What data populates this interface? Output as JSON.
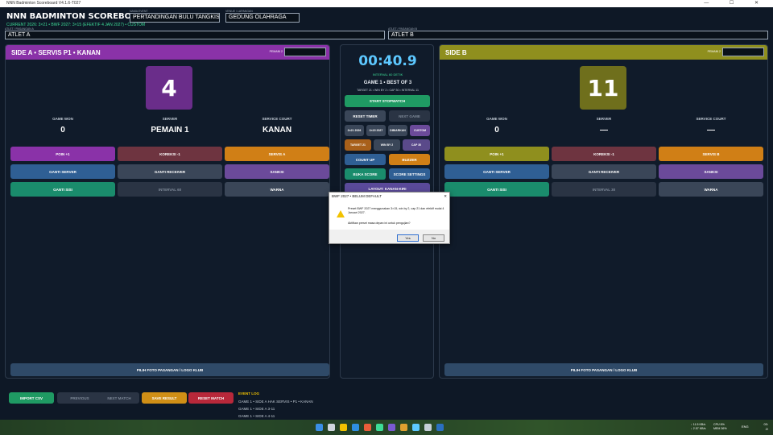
{
  "window": {
    "title": "NNN Badminton Scoreboard V4.1.6-T027",
    "controls": "— ☐ ✕"
  },
  "header": {
    "app_title": "NNN BADMINTON SCOREBOARD",
    "subtitle": "CURRENT 2026: 3×21 • BWF 2027: 3×15 (EFEKTIF 4 JAN 2027) • CUSTOM",
    "event_label": "NAMA EVENT",
    "event_value": "PERTANDINGAN BULU TANGKIS",
    "venue_label": "VENUE / LAPANGAN",
    "venue_value": "GEDUNG OLAHRAGA"
  },
  "athletes": {
    "a_label": "ATLET / PASANGAN A",
    "a_value": "ATLET A",
    "b_label": "ATLET / PASANGAN B",
    "b_value": "ATLET B"
  },
  "side_a": {
    "header": "SIDE A  • SERVIS P1 • KANAN",
    "player_label": "PEMAIN 2",
    "score": "4",
    "game_won_label": "GAME WON",
    "game_won": "0",
    "server_label": "SERVER",
    "server": "PEMAIN 1",
    "court_label": "SERVICE COURT",
    "court": "KANAN",
    "btn_point": "POIN +1",
    "btn_correct": "KOREKSI -1",
    "btn_serve": "SERVIS A",
    "btn_swap_server": "GANTI SERVER",
    "btn_swap_receiver": "GANTI RECEIVER",
    "btn_warn": "SANKSI",
    "btn_swap_side": "GANTI SISI",
    "btn_interval": "INTERVAL 60",
    "btn_color": "WARNA",
    "btn_photo": "PILIH FOTO PASANGAN / LOGO KLUB"
  },
  "side_b": {
    "header": "SIDE B",
    "player_label": "PEMAIN 2",
    "score": "11",
    "game_won_label": "GAME WON",
    "game_won": "0",
    "server_label": "SERVER",
    "server": "—",
    "court_label": "SERVICE COURT",
    "court": "—",
    "btn_point": "POIN +1",
    "btn_correct": "KOREKSI -1",
    "btn_serve": "SERVIS B",
    "btn_swap_server": "GANTI SERVER",
    "btn_swap_receiver": "GANTI RECEIVER",
    "btn_warn": "SANKSI",
    "btn_swap_side": "GANTI SISI",
    "btn_interval": "INTERVAL 30",
    "btn_color": "WARNA",
    "btn_photo": "PILIH FOTO PASANGAN / LOGO KLUB"
  },
  "center": {
    "timer": "00:40.9",
    "interval_label": "INTERVAL 60 DETIK",
    "game_info": "GAME 1 • BEST OF 3",
    "rule_info": "TARGET 21 • WIN BY 2 • CAP 30 • INTERVAL 11",
    "btn_start": "START STOPWATCH",
    "btn_reset_timer": "RESET TIMER",
    "btn_next_game": "NEXT GAME",
    "btn_r1": "3×21 2026",
    "btn_r2": "3×15 2027",
    "btn_r3": "DIBIARKAN",
    "btn_r4": "CUSTOM",
    "btn_target": "TARGET 21",
    "btn_winby": "WIN BY 2",
    "btn_cap": "CAP 30",
    "btn_countup": "COUNT UP",
    "btn_buzzer": "BUZZER",
    "btn_open_score": "BUKA SCORE",
    "btn_settings": "SCORE SETTINGS",
    "btn_layout": "LAYOUT: KANAN-KIRI"
  },
  "dialog": {
    "title": "BWF 2027 • BELUM DEFAULT",
    "message": "Preset BWF 2027 menggunakan 3×15, win by 2, cap 21 dan efektif mulai 4 Januari 2027.",
    "question": "Aktifkan preset masa depan ini untuk pengujian?",
    "yes": "Yes",
    "no": "No"
  },
  "bottom": {
    "import": "IMPORT CSV",
    "previous": "PREVIOUS",
    "next_match": "NEXT MATCH",
    "save": "SAVE RESULT",
    "reset": "RESET MATCH",
    "log_title": "EVENT LOG",
    "log": [
      "GAME 1 • SIDE A HAK SERVIS • P1 • KANAN",
      "GAME 1 • SIDE A 3-11",
      "GAME 1 • SIDE A 4-11"
    ]
  },
  "taskbar": {
    "net_up": "↑ 11.5 KB/s",
    "net_down": "↓ 2.57 KB/s",
    "cpu": "CPU  6%",
    "mem": "MEM  36%",
    "lang": "ENG",
    "time": "03:",
    "date": "2/"
  },
  "colors": {
    "side_a_accent": "#8a32a8",
    "side_b_accent": "#8f8f1e",
    "point": "#8a32a8",
    "correct": "#6e3440",
    "serve": "#d07f16",
    "blue": "#2f5f94",
    "slate": "#3a4658",
    "teal": "#1a8c6c",
    "purple": "#6b4a9a",
    "green": "#1f9a63",
    "red": "#b8283a",
    "timer": "#5dc8ff"
  }
}
